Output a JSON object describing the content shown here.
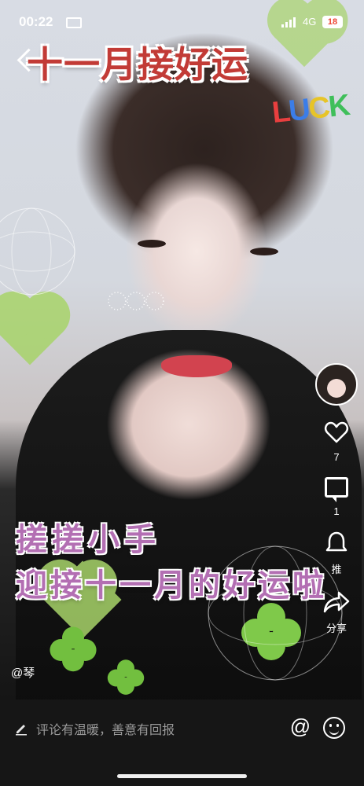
{
  "status_bar": {
    "time": "00:22",
    "network": "4G",
    "battery": "18"
  },
  "video": {
    "title_text": "十一月接好运",
    "sticker_text": "LUCK",
    "caption_line1": "搓搓小手",
    "caption_line2": "迎接十一月的好运啦",
    "author_handle": "@琴"
  },
  "sidebar": {
    "like_count": "7",
    "comment_count": "1",
    "recommend_label": "推",
    "share_label": "分享"
  },
  "comment_bar": {
    "placeholder": "评论有温暖，善意有回报",
    "at_label": "@"
  },
  "colors": {
    "title_red": "#c23b36",
    "caption_purple": "#b36fb3",
    "heart_green": "#a8d46a",
    "bar_bg": "#161616"
  }
}
